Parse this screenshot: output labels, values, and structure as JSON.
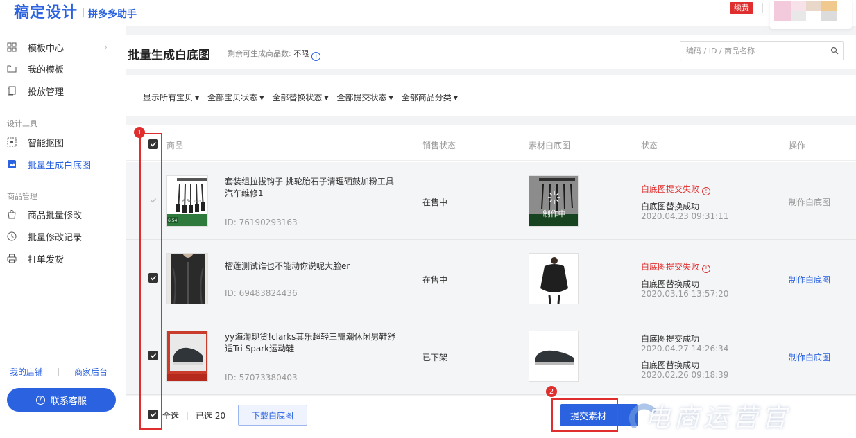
{
  "header": {
    "brand": "稿定设计",
    "sub": "拼多多助手",
    "renew": "续费"
  },
  "sidebar": {
    "items": [
      {
        "label": "模板中心",
        "icon": "grid-icon",
        "chevron": "›"
      },
      {
        "label": "我的模板",
        "icon": "folder-icon"
      },
      {
        "label": "投放管理",
        "icon": "copy-icon"
      }
    ],
    "group_design": "设计工具",
    "design_items": [
      {
        "label": "智能抠图",
        "icon": "cutout-icon"
      },
      {
        "label": "批量生成白底图",
        "icon": "image-icon",
        "active": true
      }
    ],
    "group_goods": "商品管理",
    "goods_items": [
      {
        "label": "商品批量修改",
        "icon": "bag-icon"
      },
      {
        "label": "批量修改记录",
        "icon": "clock-icon"
      },
      {
        "label": "打单发货",
        "icon": "printer-icon"
      }
    ],
    "footer_left": "我的店铺",
    "footer_right": "商家后台",
    "contact": "联系客服"
  },
  "main": {
    "title": "批量生成白底图",
    "quota_label": "剩余可生成商品数:",
    "quota_value": "不限",
    "search_placeholder": "编码 / ID / 商品名称",
    "filters": [
      "显示所有宝贝",
      "全部宝贝状态",
      "全部替换状态",
      "全部提交状态",
      "全部商品分类"
    ],
    "columns": {
      "product": "商品",
      "sale": "销售状态",
      "material": "素材白底图",
      "status": "状态",
      "action": "操作"
    },
    "rows": [
      {
        "name": "套装组拉拔钩子 挑轮胎石子清理硒鼓加粉工具汽车维修1",
        "id": "ID: 76190293163",
        "sale": "在售中",
        "material_overlay": "制作中",
        "status_fail": "白底图提交失败",
        "status_line": "白底图替换成功",
        "status_time": "2020.04.23 09:31:11",
        "action": "制作白底图"
      },
      {
        "name": "榴莲测试谁也不能动你说呢大脸er",
        "id": "ID: 69483824436",
        "sale": "在售中",
        "status_fail": "白底图提交失败",
        "status_line": "白底图替换成功",
        "status_time": "2020.03.16 13:57:20",
        "action": "制作白底图"
      },
      {
        "name": "yy海淘现货!clarks其乐超轻三瓣潮休闲男鞋舒适Tri Spark运动鞋",
        "id": "ID: 57073380403",
        "sale": "已下架",
        "status_line1": "白底图提交成功",
        "status_time1": "2020.04.27 14:26:34",
        "status_line2": "白底图替换成功",
        "status_time2": "2020.02.26 09:18:39",
        "action": "制作白底图"
      }
    ],
    "thumb1_price": "6.54",
    "thumb1_price2": "26.74",
    "bottom": {
      "select_all": "全选",
      "selected": "已选 20",
      "download": "下载白底图",
      "submit": "提交素材"
    }
  },
  "annotations": {
    "badge1": "1",
    "badge2": "2"
  },
  "watermark": "电商运营官",
  "colors": {
    "accent": "#2a62e0",
    "danger": "#e02e2e",
    "muted": "#999999"
  }
}
